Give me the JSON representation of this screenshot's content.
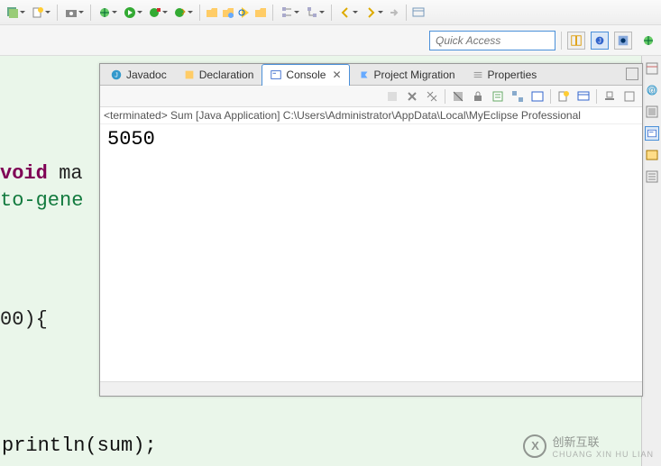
{
  "toolbar": {
    "icons": [
      "save-all-icon",
      "new-icon",
      "camera-icon",
      "debug-icon",
      "run-icon",
      "run-external-icon",
      "run-last-icon",
      "open-folder-icon",
      "open-type-icon",
      "search-icon",
      "open-task-icon",
      "tree-collapse-icon",
      "tree-expand-icon",
      "nav-back-icon",
      "nav-forward-icon",
      "nav-next-icon",
      "window-icon"
    ]
  },
  "quick": {
    "placeholder": "Quick Access",
    "perspectives": [
      "open-perspective-icon",
      "java-perspective-icon",
      "debug-perspective-icon",
      "launch-icon"
    ]
  },
  "tabs": [
    {
      "label": "Javadoc",
      "icon": "javadoc-icon",
      "active": false
    },
    {
      "label": "Declaration",
      "icon": "declaration-icon",
      "active": false
    },
    {
      "label": "Console",
      "icon": "console-icon",
      "active": true,
      "closable": true
    },
    {
      "label": "Project Migration",
      "icon": "migration-icon",
      "active": false
    },
    {
      "label": "Properties",
      "icon": "properties-icon",
      "active": false
    }
  ],
  "console": {
    "toolbar_icons": [
      "blank-icon",
      "remove-icon",
      "remove-all-icon",
      "clear-icon",
      "lock-icon",
      "pin-icon",
      "tree-icon",
      "open-console-icon",
      "new-console-icon",
      "min-icon",
      "max-icon"
    ],
    "status": "<terminated> Sum [Java Application] C:\\Users\\Administrator\\AppData\\Local\\MyEclipse Professional",
    "output": "5050"
  },
  "editor": {
    "line1_kw": "void",
    "line1_rest": " ma",
    "line2": "to-gene",
    "line3": "00){",
    "line4": "println(sum);"
  },
  "right_icons": [
    "outline-icon",
    "at-icon",
    "maximize-icon",
    "console-view-icon",
    "problems-icon",
    "tasks-icon"
  ],
  "watermark": {
    "brand": "创新互联",
    "sub": "CHUANG XIN HU LIAN",
    "logo": "X"
  }
}
